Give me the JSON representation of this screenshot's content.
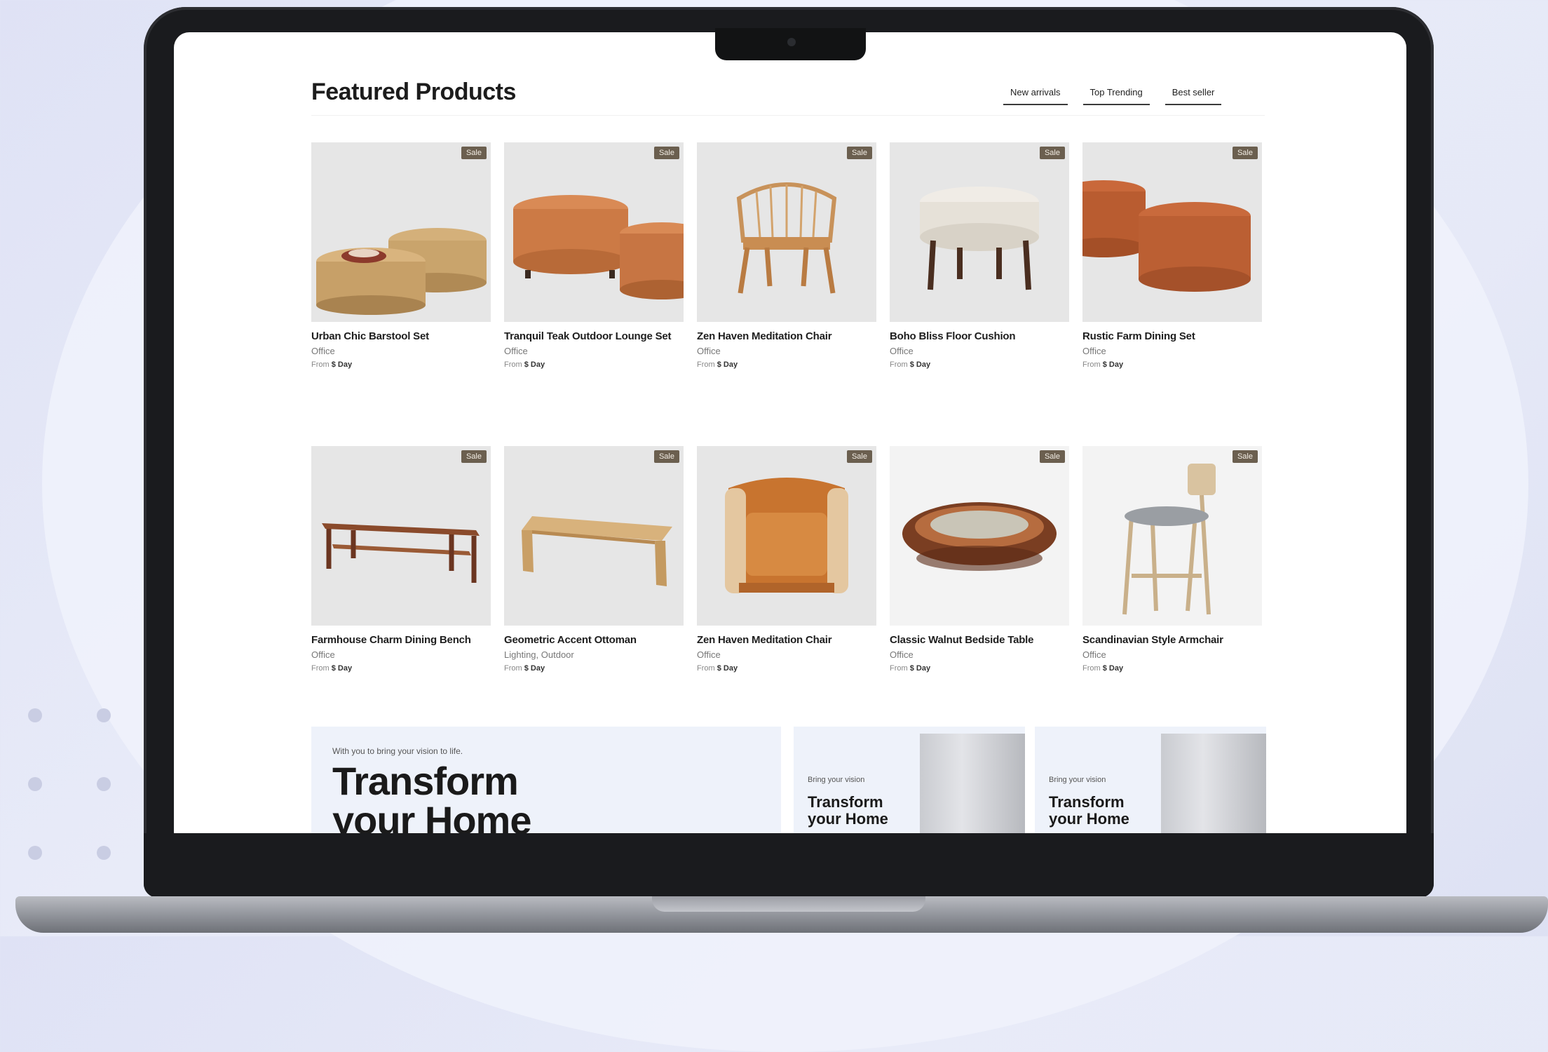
{
  "page": {
    "title": "Featured Products",
    "filters": [
      "New arrivals",
      "Top Trending",
      "Best seller"
    ]
  },
  "products": [
    {
      "name": "Urban Chic Barstool Set",
      "category": "Office",
      "price_prefix": "From",
      "price": "$ Day",
      "badge": "Sale",
      "image": "wicker-ottoman-pair"
    },
    {
      "name": "Tranquil Teak Outdoor Lounge Set",
      "category": "Office",
      "price_prefix": "From",
      "price": "$ Day",
      "badge": "Sale",
      "image": "orange-pouf-pair"
    },
    {
      "name": "Zen Haven Meditation Chair",
      "category": "Office",
      "price_prefix": "From",
      "price": "$ Day",
      "badge": "Sale",
      "image": "rattan-chair"
    },
    {
      "name": "Boho Bliss Floor Cushion",
      "category": "Office",
      "price_prefix": "From",
      "price": "$ Day",
      "badge": "Sale",
      "image": "white-ottoman"
    },
    {
      "name": "Rustic Farm Dining Set",
      "category": "Office",
      "price_prefix": "From",
      "price": "$ Day",
      "badge": "Sale",
      "image": "rust-pouf-pair"
    },
    {
      "name": "Farmhouse Charm Dining Bench",
      "category": "Office",
      "price_prefix": "From",
      "price": "$ Day",
      "badge": "Sale",
      "image": "wood-bench"
    },
    {
      "name": "Geometric Accent Ottoman",
      "category": "Lighting, Outdoor",
      "price_prefix": "From",
      "price": "$ Day",
      "badge": "Sale",
      "image": "oak-bench"
    },
    {
      "name": "Zen Haven Meditation Chair",
      "category": "Office",
      "price_prefix": "From",
      "price": "$ Day",
      "badge": "Sale",
      "image": "leather-armchair"
    },
    {
      "name": "Classic Walnut Bedside Table",
      "category": "Office",
      "price_prefix": "From",
      "price": "$ Day",
      "badge": "Sale",
      "image": "copper-bowl-table"
    },
    {
      "name": "Scandinavian Style Armchair",
      "category": "Office",
      "price_prefix": "From",
      "price": "$ Day",
      "badge": "Sale",
      "image": "bar-stool"
    }
  ],
  "banners": {
    "main": {
      "tagline": "With you to bring your vision to life.",
      "heading_line1": "Transform",
      "heading_line2": "your Home"
    },
    "small": [
      {
        "tagline": "Bring your vision",
        "heading_line1": "Transform",
        "heading_line2": "your Home"
      },
      {
        "tagline": "Bring your vision",
        "heading_line1": "Transform",
        "heading_line2": "your Home"
      }
    ]
  },
  "colors": {
    "badge_bg": "#6b5f4f",
    "accent_orange": "#c9743f",
    "background": "#e6e9f7"
  }
}
